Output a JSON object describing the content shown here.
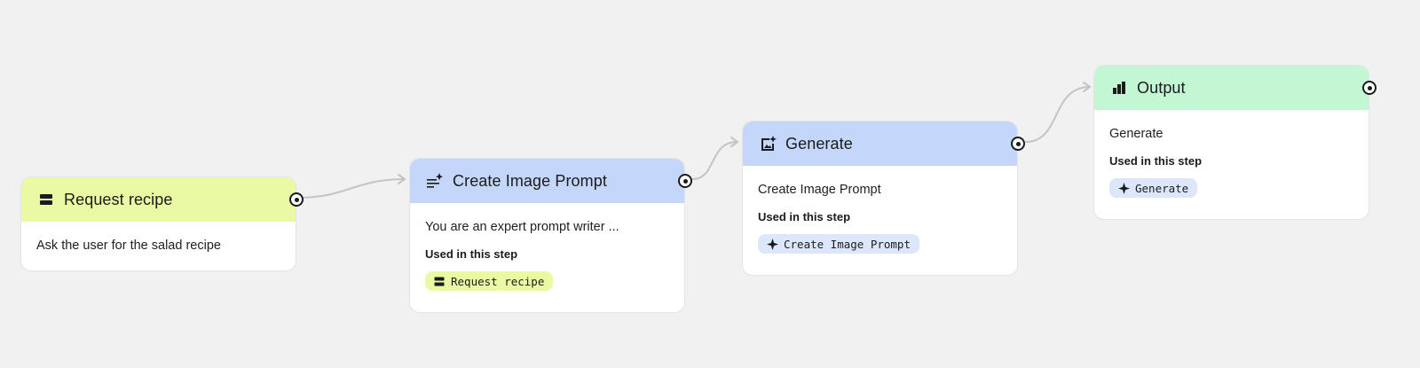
{
  "colors": {
    "canvas_bg": "#f1f1f1",
    "input_header": "#eaf9a3",
    "generate_header": "#c4d7fb",
    "output_header": "#c3f7d4",
    "chip_input": "#eaf9a3",
    "chip_generate": "#dde7fc",
    "connector": "#c4c4c4"
  },
  "nodes": [
    {
      "id": "request-recipe",
      "title": "Request recipe",
      "icon": "input-icon",
      "body": "Ask the user for the salad recipe"
    },
    {
      "id": "create-image-prompt",
      "title": "Create Image Prompt",
      "icon": "text-sparkle-icon",
      "body": "You are an expert prompt writer ...",
      "used_label": "Used in this step",
      "chip": {
        "label": "Request recipe",
        "icon": "input-icon"
      }
    },
    {
      "id": "generate",
      "title": "Generate",
      "icon": "image-sparkle-icon",
      "body": "Create Image Prompt",
      "used_label": "Used in this step",
      "chip": {
        "label": "Create Image Prompt",
        "icon": "sparkle-icon"
      }
    },
    {
      "id": "output",
      "title": "Output",
      "icon": "output-chart-icon",
      "body": "Generate",
      "used_label": "Used in this step",
      "chip": {
        "label": "Generate",
        "icon": "sparkle-icon"
      }
    }
  ]
}
